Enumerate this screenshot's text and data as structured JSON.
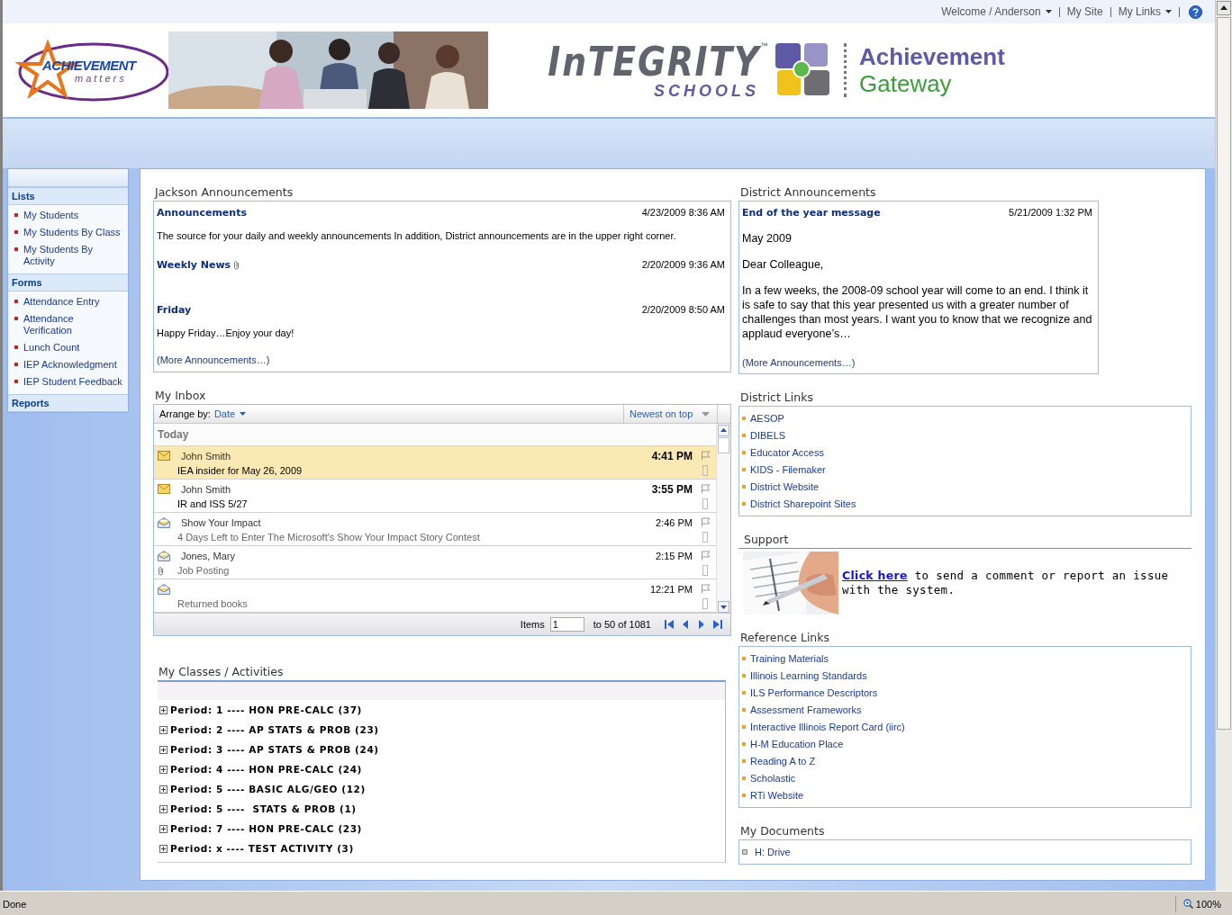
{
  "top_links": [
    {
      "label": "Welcome / Anderson",
      "dropdown": true
    },
    {
      "label": "My Site",
      "dropdown": false
    },
    {
      "label": "My Links",
      "dropdown": true
    }
  ],
  "banner": {
    "logo_word": "ACHIEVEMENT",
    "logo_tagline": "matters",
    "school_name": "InTEGRITY",
    "trademark": "™",
    "school_sub": "SCHOOLS",
    "title_line1": "Achievement",
    "title_line2": "Gateway"
  },
  "quick_launch": [
    {
      "heading": "Lists",
      "items": [
        "My Students",
        "My Students By Class",
        "My Students By Activity"
      ]
    },
    {
      "heading": "Forms",
      "items": [
        "Attendance Entry",
        "Attendance Verification",
        "Lunch Count",
        "IEP Acknowledgment",
        "IEP Student Feedback"
      ]
    },
    {
      "heading": "Reports"
    }
  ],
  "jackson_announcements": {
    "title": "Jackson Announcements",
    "items": [
      {
        "title": "Announcements",
        "attachment": false,
        "date": "4/23/2009 8:36 AM",
        "body": "The source for your daily and weekly announcements  In addition, District announcements are in the upper right corner."
      },
      {
        "title": "Weekly News",
        "attachment": true,
        "date": "2/20/2009 9:36 AM"
      },
      {
        "title": "Friday",
        "attachment": false,
        "date": "2/20/2009 8:50 AM",
        "body": "Happy Friday…Enjoy your day!"
      }
    ],
    "more_link": "(More Announcements…)"
  },
  "inbox": {
    "title": "My Inbox",
    "arrange_label": "Arrange by:",
    "arrange_value": "Date",
    "sort": "Newest on top",
    "group": "Today",
    "messages": [
      {
        "sender": "John Smith",
        "subject": "IEA insider for May 26, 2009",
        "time": "4:41 PM",
        "unread": true,
        "selected": true,
        "attachment": false
      },
      {
        "sender": "John Smith",
        "subject": "IR and ISS 5/27",
        "time": "3:55 PM",
        "unread": true,
        "selected": false,
        "attachment": false
      },
      {
        "sender": "Show Your Impact",
        "subject": "4 Days Left to Enter The Microsoft's Show Your Impact Story Contest",
        "time": "2:46 PM",
        "unread": false,
        "selected": false,
        "attachment": false
      },
      {
        "sender": "Jones, Mary",
        "subject": "Job Posting",
        "time": "2:15 PM",
        "unread": false,
        "selected": false,
        "attachment": true
      },
      {
        "subject": "Returned books",
        "time": "12:21 PM",
        "unread": false,
        "selected": false,
        "attachment": false
      }
    ],
    "pager": {
      "label": "Items",
      "value": "1",
      "range": "to 50 of 1081"
    }
  },
  "classes": {
    "title": "My Classes / Activities",
    "rows": [
      {
        "label": "Period: 1 ---- HON PRE-CALC (37)",
        "expanded": false
      },
      {
        "label": "Period: 2 ---- AP STATS & PROB (23)",
        "expanded": false
      },
      {
        "label": "Period: 3 ---- AP STATS & PROB (24)",
        "expanded": false
      },
      {
        "label": "Period: 4 ---- HON PRE-CALC (24)",
        "expanded": false
      },
      {
        "label": "Period: 5 ---- BASIC ALG/GEO (12)",
        "expanded": false
      },
      {
        "label": "Period: 5 ----  STATS & PROB (1)",
        "expanded": false
      },
      {
        "label": "Period: 7 ---- HON PRE-CALC (23)",
        "expanded": false
      },
      {
        "label": "Period: x ---- TEST ACTIVITY (3)",
        "expanded": false
      }
    ]
  },
  "district_announcements": {
    "title": "District Announcements",
    "items": [
      {
        "title": "End of the year message",
        "date": "5/21/2009 1:32 PM",
        "paragraphs": [
          "May 2009",
          "Dear Colleague,",
          "In a few weeks, the 2008-09 school year will come to an end. I think it is safe to say that this year presented us with a greater number of challenges than most years. I want you to know that we recognize and applaud everyone’s…"
        ]
      }
    ],
    "more_link": "(More Announcements…)"
  },
  "district_links": {
    "title": "District Links",
    "links": [
      "AESOP",
      "DIBELS",
      "Educator Access",
      "KIDS - Filemaker",
      "District  Website",
      "District Sharepoint Sites"
    ]
  },
  "support": {
    "title": "Support",
    "link": "Click here",
    "text": " to send a comment or report an issue with the system."
  },
  "reference_links": {
    "title": "Reference Links",
    "links": [
      "Training Materials",
      "Illinois Learning Standards",
      "ILS Performance Descriptors",
      "Assessment Frameworks",
      "Interactive Illinois Report Card (iirc)",
      "H-M Education Place",
      "Reading A to Z",
      "Scholastic",
      "RTi Website"
    ]
  },
  "my_documents": {
    "title": "My Documents",
    "items": [
      "H: Drive"
    ]
  },
  "status_bar": {
    "text": "Done",
    "zoom": "100%"
  }
}
